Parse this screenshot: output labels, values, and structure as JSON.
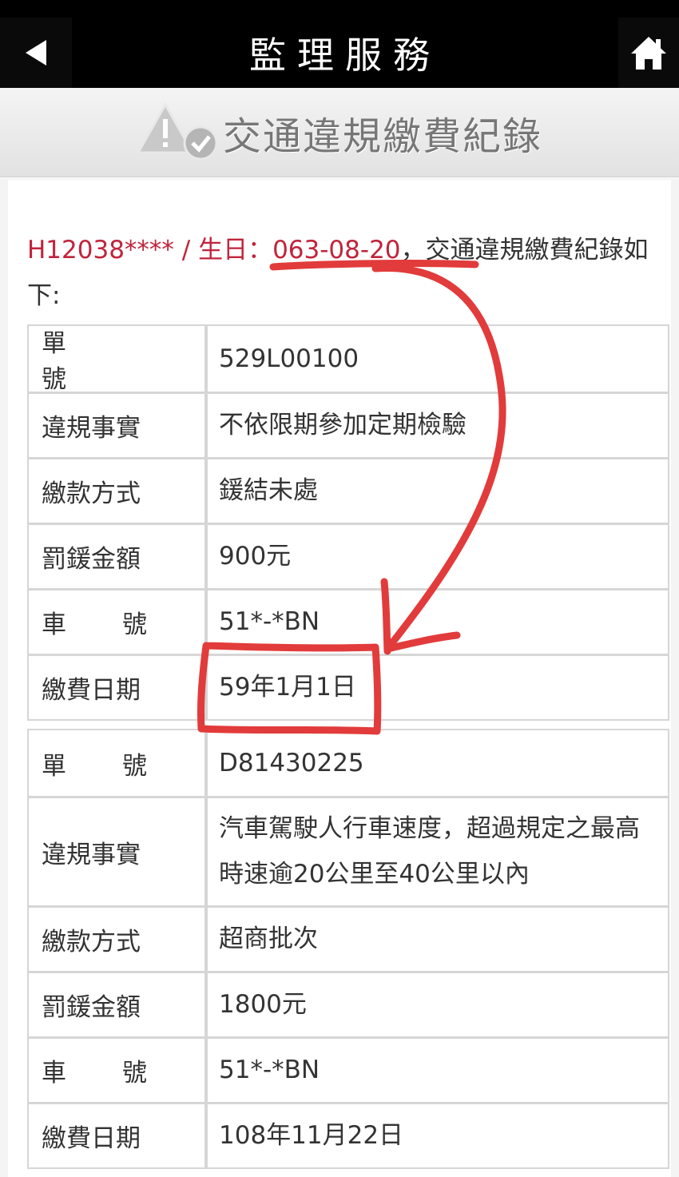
{
  "topbar": {
    "title": "監理服務",
    "back_icon": "back-arrow-icon",
    "home_icon": "home-icon"
  },
  "section": {
    "title": "交通違規繳費紀錄",
    "icon": "warning-check-icon"
  },
  "intro": {
    "id_and_birth": "H12038**** / 生日：063-08-20",
    "suffix": "，交通違規繳費紀錄如下:"
  },
  "records": [
    {
      "rows": [
        {
          "label": "單號",
          "value": "529L00100"
        },
        {
          "label": "違規事實",
          "value": "不依限期參加定期檢驗"
        },
        {
          "label": "繳款方式",
          "value": "鍰結未處"
        },
        {
          "label": "罰鍰金額",
          "value": "900元"
        },
        {
          "label": "車號",
          "value": "51*-*BN"
        },
        {
          "label": "繳費日期",
          "value": "59年1月1日"
        }
      ]
    },
    {
      "rows": [
        {
          "label": "單號",
          "value": "D81430225"
        },
        {
          "label": "違規事實",
          "value": "汽車駕駛人行車速度，超過規定之最高時速逾20公里至40公里以內"
        },
        {
          "label": "繳款方式",
          "value": "超商批次"
        },
        {
          "label": "罰鍰金額",
          "value": "1800元"
        },
        {
          "label": "車號",
          "value": "51*-*BN"
        },
        {
          "label": "繳費日期",
          "value": "108年11月22日"
        }
      ]
    }
  ],
  "colors": {
    "topbar": "#000000",
    "highlight_text": "#c0243c",
    "annotation": "#e23b3b",
    "border": "#d6d6d6"
  }
}
